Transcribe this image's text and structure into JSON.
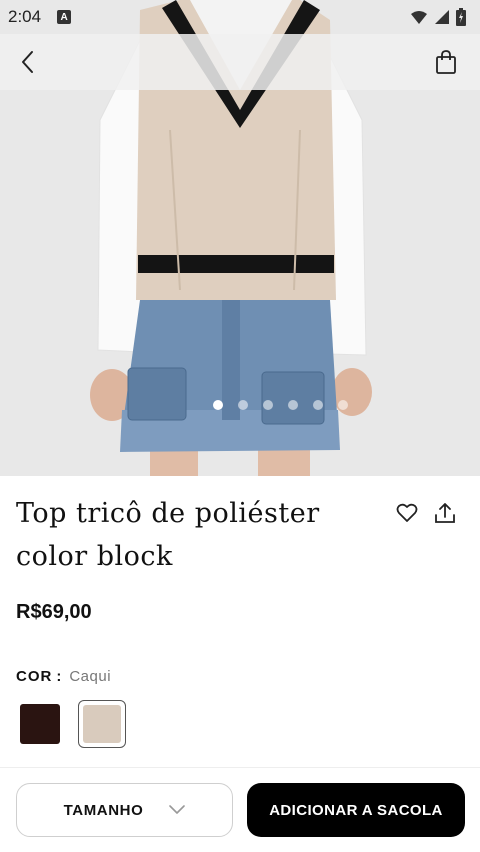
{
  "status_bar": {
    "time": "2:04",
    "notification_icon": "a-icon",
    "wifi_icon": "wifi-icon",
    "signal_icon": "signal-icon",
    "battery_icon": "battery-icon"
  },
  "nav": {
    "back_icon": "chevron-left-icon",
    "bag_icon": "shopping-bag-icon"
  },
  "carousel": {
    "image_count": 6,
    "active_index": 0
  },
  "product": {
    "title": "Top tricô de poliéster color block",
    "price": "R$69,00",
    "wishlist_icon": "heart-icon",
    "share_icon": "share-icon"
  },
  "color": {
    "label": "COR",
    "separator": ":",
    "selected": "Caqui",
    "swatches": [
      {
        "color": "#2a1411",
        "selected": false
      },
      {
        "color": "#d9cbbd",
        "selected": true
      }
    ]
  },
  "actions": {
    "size_label": "TAMANHO",
    "add_label": "ADICIONAR A SACOLA"
  }
}
